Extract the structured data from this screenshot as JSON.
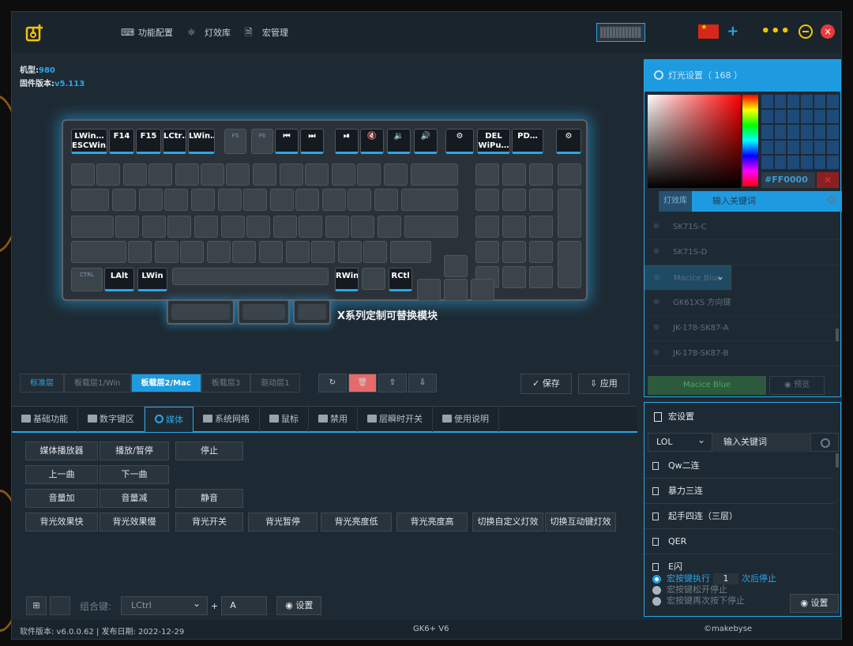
{
  "nav": [
    {
      "label": "功能配置",
      "icon": "keyboard-icon"
    },
    {
      "label": "灯效库",
      "icon": "light-icon"
    },
    {
      "label": "宏管理",
      "icon": "document-icon"
    }
  ],
  "device": {
    "model_label": "机型:",
    "model_value": "980",
    "firmware_label": "固件版本:",
    "firmware_value": "v5.113"
  },
  "keyboard": {
    "fkeys": [
      "LWin… ESCWin…",
      "F14",
      "F15",
      "LCtr…",
      "LWin…",
      "F5",
      "F6",
      "⏮",
      "⏭",
      "⏯",
      "🔇",
      "🔉",
      "🔊",
      "⚙",
      "DEL WiPu…",
      "PD…",
      "⚙"
    ],
    "mods": {
      "lalt": "LAlt",
      "lwin": "LWin",
      "rwin": "RWin",
      "rctl": "RCtl",
      "ctrl": "CTRL"
    },
    "module_label": "X系列定制可替换模块"
  },
  "layers": [
    "标准层",
    "板载层1/Win",
    "板载层2/Mac",
    "板载层3",
    "驱动层1"
  ],
  "actions": {
    "save": "保存",
    "apply": "应用"
  },
  "tabs": [
    "基础功能",
    "数字键区",
    "媒体",
    "系统网络",
    "鼠标",
    "禁用",
    "层瞬时开关",
    "使用说明"
  ],
  "media_buttons": [
    "媒体播放器",
    "播放/暂停",
    "停止",
    "上一曲",
    "下一曲",
    "音量加",
    "音量减",
    "静音",
    "背光效果快",
    "背光效果慢",
    "背光开关",
    "背光暂停",
    "背光亮度低",
    "背光亮度高",
    "切换自定义灯效",
    "切换互动键灯效"
  ],
  "combo": {
    "label": "组合键:",
    "modifier": "LCtrl",
    "plus": "+",
    "key": "A",
    "set": "设置"
  },
  "status": {
    "version": "软件版本: v6.0.0.62 | 发布日期: 2022-12-29",
    "model": "GK6+ V6",
    "credit": "©makebyse"
  },
  "lighting": {
    "title": "灯光设置（ 168 ）",
    "hex": "#FF0000",
    "lib_tab": "灯效库",
    "search_placeholder": "输入关键词",
    "items": [
      "SK71S-C",
      "SK71S-D",
      "Macice Blue",
      "GK61XS 方向键",
      "JK-178-SK87-A",
      "JK-178-SK87-B"
    ],
    "selected": "Macice Blue",
    "apply_label": "Macice Blue",
    "preview": "预览"
  },
  "macro": {
    "title": "宏设置",
    "filter": "LOL",
    "search_placeholder": "输入关键词",
    "items": [
      "Qw二连",
      "暴力三连",
      "起手四连（三层）",
      "QER",
      "E闪"
    ],
    "opt1_pre": "宏按键执行",
    "opt1_count": "1",
    "opt1_post": "次后停止",
    "opt2": "宏按键松开停止",
    "opt3": "宏按键再次按下停止",
    "set": "设置"
  },
  "colors": {
    "accent": "#2aa6e8",
    "active": "#1e9be0",
    "panel": "#1e2a33",
    "warn": "#f5c400"
  }
}
